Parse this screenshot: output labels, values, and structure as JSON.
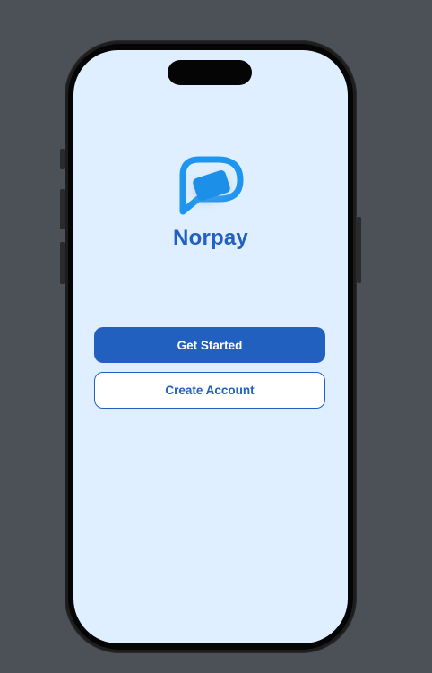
{
  "app": {
    "name": "Norpay",
    "logo_icon": "norpay-chat-bubble-logo-icon"
  },
  "actions": {
    "get_started_label": "Get Started",
    "create_account_label": "Create Account"
  },
  "colors": {
    "background_outer": "#4b5157",
    "screen_background": "#dfefff",
    "brand_primary": "#2260c0",
    "logo_blue": "#1e96f0",
    "button_text_primary": "#ffffff"
  }
}
